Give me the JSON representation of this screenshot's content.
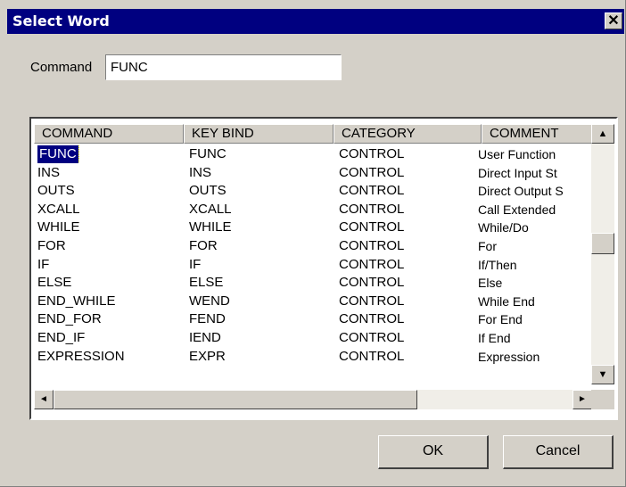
{
  "window": {
    "title": "Select Word",
    "close_glyph": "✕"
  },
  "command": {
    "label": "Command",
    "value": "FUNC"
  },
  "table": {
    "columns": [
      "COMMAND",
      "KEY BIND",
      "CATEGORY",
      "COMMENT"
    ],
    "selected_row": 0,
    "rows": [
      [
        "FUNC",
        "FUNC",
        "CONTROL",
        "User Function"
      ],
      [
        "INS",
        "INS",
        "CONTROL",
        "Direct Input St"
      ],
      [
        "OUTS",
        "OUTS",
        "CONTROL",
        "Direct Output S"
      ],
      [
        "XCALL",
        "XCALL",
        "CONTROL",
        "Call Extended"
      ],
      [
        "WHILE",
        "WHILE",
        "CONTROL",
        "While/Do"
      ],
      [
        "FOR",
        "FOR",
        "CONTROL",
        "For"
      ],
      [
        "IF",
        "IF",
        "CONTROL",
        "If/Then"
      ],
      [
        "ELSE",
        "ELSE",
        "CONTROL",
        "Else"
      ],
      [
        "END_WHILE",
        "WEND",
        "CONTROL",
        "While End"
      ],
      [
        "END_FOR",
        "FEND",
        "CONTROL",
        "For End"
      ],
      [
        "END_IF",
        "IEND",
        "CONTROL",
        "If End"
      ],
      [
        "EXPRESSION",
        "EXPR",
        "CONTROL",
        "Expression"
      ]
    ]
  },
  "buttons": {
    "ok": "OK",
    "cancel": "Cancel"
  },
  "icons": {
    "scroll_up": "▲",
    "scroll_down": "▼",
    "scroll_left": "◄",
    "scroll_right": "►"
  }
}
